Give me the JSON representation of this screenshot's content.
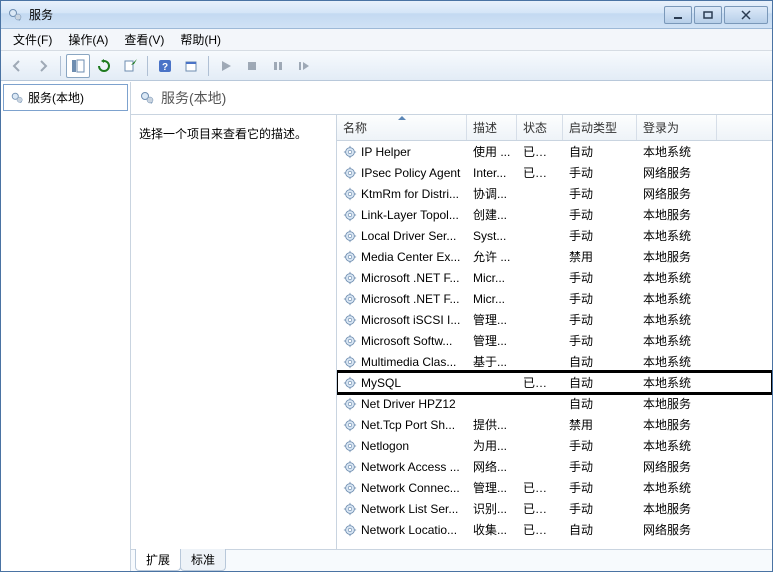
{
  "window": {
    "title": "服务"
  },
  "menu": {
    "file": "文件(F)",
    "action": "操作(A)",
    "view": "查看(V)",
    "help": "帮助(H)"
  },
  "left": {
    "root": "服务(本地)"
  },
  "right": {
    "heading": "服务(本地)",
    "prompt": "选择一个项目来查看它的描述。"
  },
  "columns": {
    "name": "名称",
    "description": "描述",
    "status": "状态",
    "startup": "启动类型",
    "logon": "登录为"
  },
  "services": [
    {
      "name": "IP Helper",
      "desc": "使用 ...",
      "status": "已启动",
      "startup": "自动",
      "logon": "本地系统",
      "highlight": false
    },
    {
      "name": "IPsec Policy Agent",
      "desc": "Inter...",
      "status": "已启动",
      "startup": "手动",
      "logon": "网络服务",
      "highlight": false
    },
    {
      "name": "KtmRm for Distri...",
      "desc": "协调...",
      "status": "",
      "startup": "手动",
      "logon": "网络服务",
      "highlight": false
    },
    {
      "name": "Link-Layer Topol...",
      "desc": "创建...",
      "status": "",
      "startup": "手动",
      "logon": "本地服务",
      "highlight": false
    },
    {
      "name": "Local Driver Ser...",
      "desc": "Syst...",
      "status": "",
      "startup": "手动",
      "logon": "本地系统",
      "highlight": false
    },
    {
      "name": "Media Center Ex...",
      "desc": "允许 ...",
      "status": "",
      "startup": "禁用",
      "logon": "本地服务",
      "highlight": false
    },
    {
      "name": "Microsoft .NET F...",
      "desc": "Micr...",
      "status": "",
      "startup": "手动",
      "logon": "本地系统",
      "highlight": false
    },
    {
      "name": "Microsoft .NET F...",
      "desc": "Micr...",
      "status": "",
      "startup": "手动",
      "logon": "本地系统",
      "highlight": false
    },
    {
      "name": "Microsoft iSCSI I...",
      "desc": "管理...",
      "status": "",
      "startup": "手动",
      "logon": "本地系统",
      "highlight": false
    },
    {
      "name": "Microsoft Softw...",
      "desc": "管理...",
      "status": "",
      "startup": "手动",
      "logon": "本地系统",
      "highlight": false
    },
    {
      "name": "Multimedia Clas...",
      "desc": "基于...",
      "status": "",
      "startup": "自动",
      "logon": "本地系统",
      "highlight": false
    },
    {
      "name": "MySQL",
      "desc": "",
      "status": "已启动",
      "startup": "自动",
      "logon": "本地系统",
      "highlight": true
    },
    {
      "name": "Net Driver HPZ12",
      "desc": "",
      "status": "",
      "startup": "自动",
      "logon": "本地服务",
      "highlight": false
    },
    {
      "name": "Net.Tcp Port Sh...",
      "desc": "提供...",
      "status": "",
      "startup": "禁用",
      "logon": "本地服务",
      "highlight": false
    },
    {
      "name": "Netlogon",
      "desc": "为用...",
      "status": "",
      "startup": "手动",
      "logon": "本地系统",
      "highlight": false
    },
    {
      "name": "Network Access ...",
      "desc": "网络...",
      "status": "",
      "startup": "手动",
      "logon": "网络服务",
      "highlight": false
    },
    {
      "name": "Network Connec...",
      "desc": "管理...",
      "status": "已启动",
      "startup": "手动",
      "logon": "本地系统",
      "highlight": false
    },
    {
      "name": "Network List Ser...",
      "desc": "识别...",
      "status": "已启动",
      "startup": "手动",
      "logon": "本地服务",
      "highlight": false
    },
    {
      "name": "Network Locatio...",
      "desc": "收集...",
      "status": "已启动",
      "startup": "自动",
      "logon": "网络服务",
      "highlight": false
    }
  ],
  "tabs": {
    "extended": "扩展",
    "standard": "标准"
  }
}
